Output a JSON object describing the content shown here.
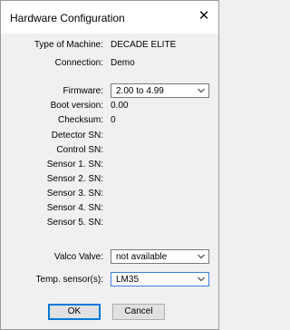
{
  "window": {
    "title": "Hardware Configuration",
    "close_glyph": "✕"
  },
  "info": [
    {
      "label": "Type of Machine:",
      "value": "DECADE ELITE"
    },
    {
      "label": "Connection:",
      "value": "Demo"
    }
  ],
  "firmware": {
    "label": "Firmware:",
    "selected": "2.00 to 4.99"
  },
  "details": [
    {
      "label": "Boot version:",
      "value": "0.00"
    },
    {
      "label": "Checksum:",
      "value": "0"
    },
    {
      "label": "Detector SN:",
      "value": ""
    },
    {
      "label": "Control SN:",
      "value": ""
    },
    {
      "label": "Sensor 1. SN:",
      "value": ""
    },
    {
      "label": "Sensor 2. SN:",
      "value": ""
    },
    {
      "label": "Sensor 3. SN:",
      "value": ""
    },
    {
      "label": "Sensor 4. SN:",
      "value": ""
    },
    {
      "label": "Sensor 5. SN:",
      "value": ""
    }
  ],
  "valco": {
    "label": "Valco Valve:",
    "selected": "not available"
  },
  "temp": {
    "label": "Temp. sensor(s):",
    "selected": "LM35"
  },
  "buttons": {
    "ok": "OK",
    "cancel": "Cancel"
  },
  "colors": {
    "focus_border": "#3c7fd6",
    "default_button_border": "#0078d7",
    "dialog_bg": "#f0f0f0"
  }
}
